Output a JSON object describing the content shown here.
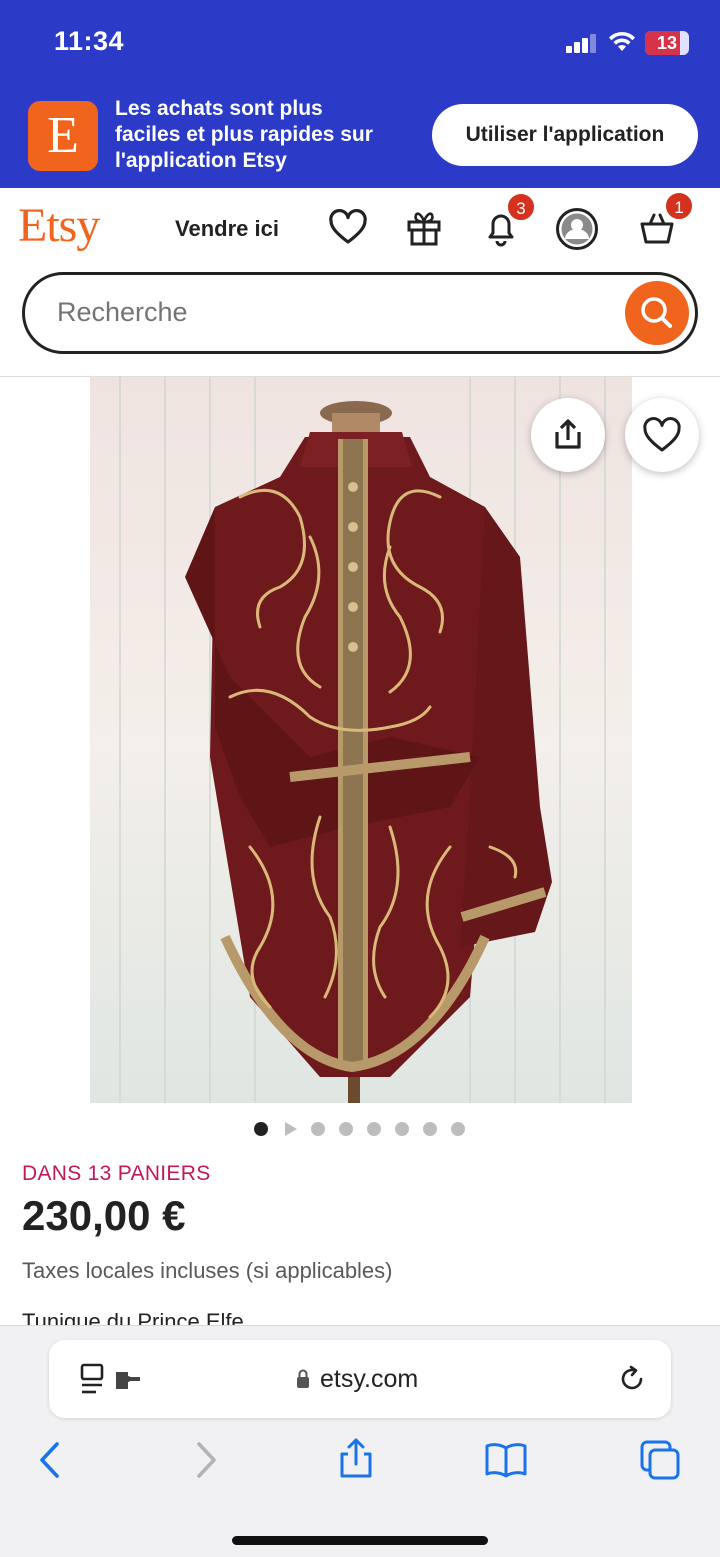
{
  "status_bar": {
    "time": "11:34",
    "battery": "13"
  },
  "app_banner": {
    "logo_letter": "E",
    "message_lines": [
      "Les achats sont plus",
      "faciles et plus rapides sur",
      "l'application Etsy"
    ],
    "button_label": "Utiliser l'application"
  },
  "header": {
    "logo": "Etsy",
    "sell_label": "Vendre ici",
    "notifications_count": "3",
    "cart_count": "1"
  },
  "search": {
    "placeholder": "Recherche"
  },
  "carousel": {
    "total_items": 8,
    "active_index": 0,
    "video_index": 1
  },
  "product": {
    "baskets_label": "DANS 13 PANIERS",
    "price": "230,00 €",
    "taxes_note": "Taxes locales incluses (si applicables)",
    "title": "Tunique du Prince Elfe"
  },
  "browser": {
    "url": "etsy.com"
  },
  "colors": {
    "banner_blue": "#2b3bc8",
    "etsy_orange": "#f1641e",
    "badge_red": "#d5311f",
    "baskets_pink": "#c2185b",
    "ios_blue": "#1a73e8"
  }
}
